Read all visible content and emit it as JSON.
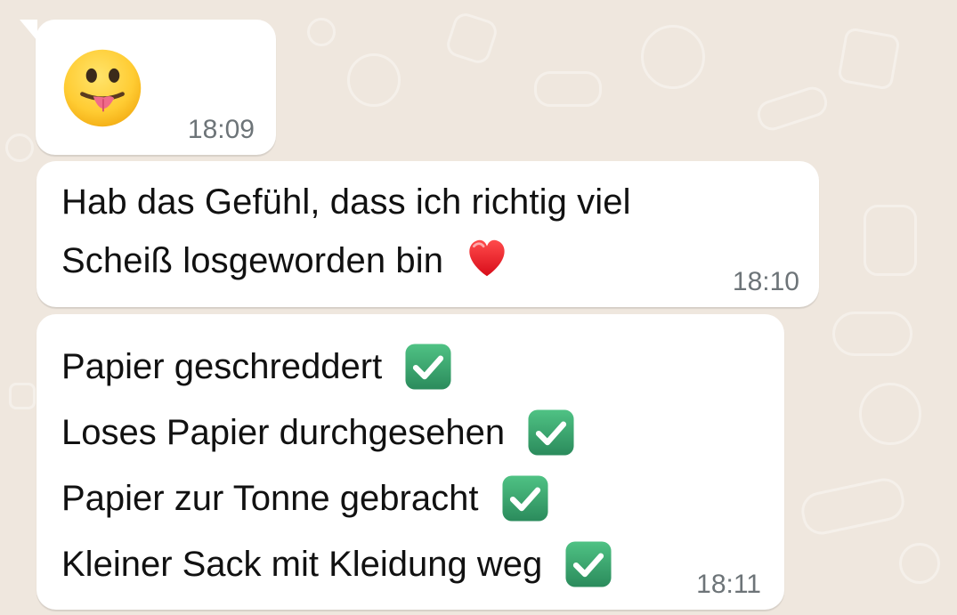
{
  "chat": {
    "background_color": "#efe7de",
    "messages": [
      {
        "emoji": "face-with-tongue",
        "time": "18:09"
      },
      {
        "line1": "Hab das Gefühl, dass ich richtig viel",
        "line2": "Scheiß losgeworden bin",
        "line2_emoji": "red-heart",
        "time": "18:10"
      },
      {
        "items": [
          {
            "label": "Papier geschreddert",
            "emoji": "check-mark-button"
          },
          {
            "label": "Loses Papier durchgesehen",
            "emoji": "check-mark-button"
          },
          {
            "label": "Papier zur Tonne gebracht",
            "emoji": "check-mark-button"
          },
          {
            "label": "Kleiner Sack mit Kleidung weg",
            "emoji": "check-mark-button"
          }
        ],
        "time": "18:11"
      }
    ]
  },
  "colors": {
    "bubble": "#ffffff",
    "timestamp": "#6d7478",
    "text": "#111111",
    "checkbox_green": "#39a46f"
  }
}
